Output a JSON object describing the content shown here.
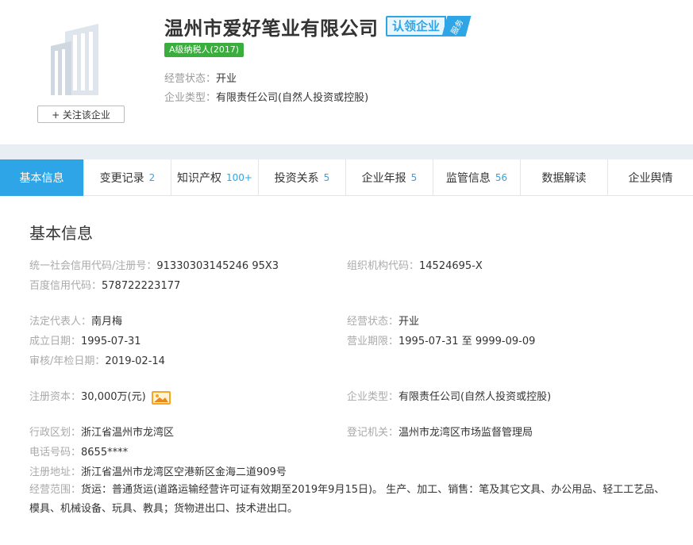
{
  "company": {
    "name": "温州市爱好笔业有限公司",
    "claim_label": "认领企业",
    "claim_tag": "服务",
    "tax_badge": "A级纳税人(2017)",
    "follow_button": "+ 关注该企业",
    "status_label": "经营状态：",
    "status_value": "开业",
    "type_label": "企业类型：",
    "type_value": "有限责任公司(自然人投资或控股)"
  },
  "tabs": [
    {
      "label": "基本信息",
      "count": ""
    },
    {
      "label": "变更记录",
      "count": "2"
    },
    {
      "label": "知识产权",
      "count": "100+"
    },
    {
      "label": "投资关系",
      "count": "5"
    },
    {
      "label": "企业年报",
      "count": "5"
    },
    {
      "label": "监管信息",
      "count": "56"
    },
    {
      "label": "数据解读",
      "count": ""
    },
    {
      "label": "企业舆情",
      "count": ""
    }
  ],
  "basic_info": {
    "title": "基本信息",
    "credit_code": {
      "label": "统一社会信用代码/注册号：",
      "value": "91330303145246 95X3"
    },
    "org_code": {
      "label": "组织机构代码：",
      "value": "14524695-X"
    },
    "baidu_code": {
      "label": "百度信用代码：",
      "value": "578722223177"
    },
    "legal_rep": {
      "label": "法定代表人：",
      "value": "南月梅"
    },
    "status": {
      "label": "经营状态：",
      "value": "开业"
    },
    "established": {
      "label": "成立日期：",
      "value": "1995-07-31"
    },
    "term": {
      "label": "营业期限：",
      "value": "1995-07-31 至 9999-09-09"
    },
    "audit_date": {
      "label": "审核/年检日期：",
      "value": "2019-02-14"
    },
    "capital": {
      "label": "注册资本：",
      "value": "30,000万(元)"
    },
    "company_type": {
      "label": "企业类型：",
      "value": "有限责任公司(自然人投资或控股)"
    },
    "region": {
      "label": "行政区划：",
      "value": "浙江省温州市龙湾区"
    },
    "authority": {
      "label": "登记机关：",
      "value": "温州市龙湾区市场监督管理局"
    },
    "phone": {
      "label": "电话号码：",
      "value": "8655****"
    },
    "address": {
      "label": "注册地址：",
      "value": "浙江省温州市龙湾区空港新区金海二道909号"
    },
    "scope": {
      "label": "经营范围：",
      "value": "货运：普通货运(道路运输经营许可证有效期至2019年9月15日)。 生产、加工、销售：笔及其它文具、办公用品、轻工工艺品、模具、机械设备、玩具、教具；货物进出口、技术进出口。"
    }
  },
  "colors": {
    "accent": "#2ea5e6",
    "tax_green": "#3aae3d",
    "image_icon": "#f5a623"
  },
  "icons": {
    "logo": "building-icon",
    "capital_image": "image-icon"
  }
}
